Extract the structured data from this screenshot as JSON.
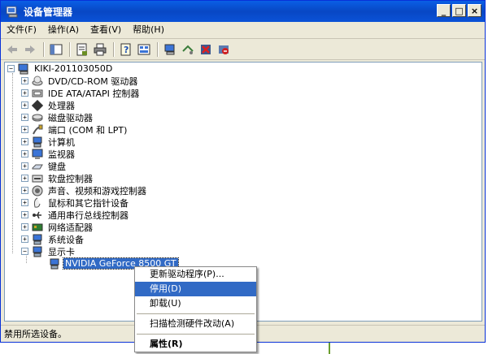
{
  "window": {
    "title": "设备管理器",
    "icon": "device-manager-icon",
    "buttons": [
      "_",
      "□",
      "×"
    ]
  },
  "menubar": [
    {
      "label": "文件(F)"
    },
    {
      "label": "操作(A)"
    },
    {
      "label": "查看(V)"
    },
    {
      "label": "帮助(H)"
    }
  ],
  "toolbar": [
    "back-icon",
    "forward-icon",
    "separator",
    "properties-icon",
    "print-icon",
    "help-icon",
    "view-icon",
    "separator",
    "computer-icon",
    "scan-hardware-icon",
    "uninstall-icon",
    "disable-icon"
  ],
  "tree": {
    "root": "KIKI-201103050D",
    "items": [
      {
        "label": "DVD/CD-ROM 驱动器",
        "icon": "cdrom-icon",
        "expanded": false
      },
      {
        "label": "IDE ATA/ATAPI 控制器",
        "icon": "ide-icon",
        "expanded": false
      },
      {
        "label": "处理器",
        "icon": "processor-icon",
        "expanded": false
      },
      {
        "label": "磁盘驱动器",
        "icon": "disk-icon",
        "expanded": false
      },
      {
        "label": "端口 (COM 和 LPT)",
        "icon": "port-icon",
        "expanded": false
      },
      {
        "label": "计算机",
        "icon": "computer-icon",
        "expanded": false
      },
      {
        "label": "监视器",
        "icon": "monitor-icon",
        "expanded": false
      },
      {
        "label": "键盘",
        "icon": "keyboard-icon",
        "expanded": false
      },
      {
        "label": "软盘控制器",
        "icon": "floppy-icon",
        "expanded": false
      },
      {
        "label": "声音、视频和游戏控制器",
        "icon": "sound-icon",
        "expanded": false
      },
      {
        "label": "鼠标和其它指针设备",
        "icon": "mouse-icon",
        "expanded": false
      },
      {
        "label": "通用串行总线控制器",
        "icon": "usb-icon",
        "expanded": false
      },
      {
        "label": "网络适配器",
        "icon": "network-icon",
        "expanded": false
      },
      {
        "label": "系统设备",
        "icon": "system-icon",
        "expanded": false
      },
      {
        "label": "显示卡",
        "icon": "display-icon",
        "expanded": true
      }
    ],
    "child": {
      "label": "NVIDIA GeForce 8500 GT",
      "icon": "display-adapter-icon",
      "selected": true
    }
  },
  "context_menu": {
    "items": [
      {
        "label": "更新驱动程序(P)..."
      },
      {
        "label": "停用(D)",
        "highlighted": true
      },
      {
        "label": "卸载(U)"
      },
      {
        "separator": true
      },
      {
        "label": "扫描检测硬件改动(A)"
      },
      {
        "separator": true
      },
      {
        "label": "属性(R)",
        "bold": true
      }
    ]
  },
  "statusbar": {
    "text": "禁用所选设备。"
  },
  "colors": {
    "titlebar": "#0a52d7",
    "selection": "#316ac5",
    "chrome": "#ece9d8"
  }
}
